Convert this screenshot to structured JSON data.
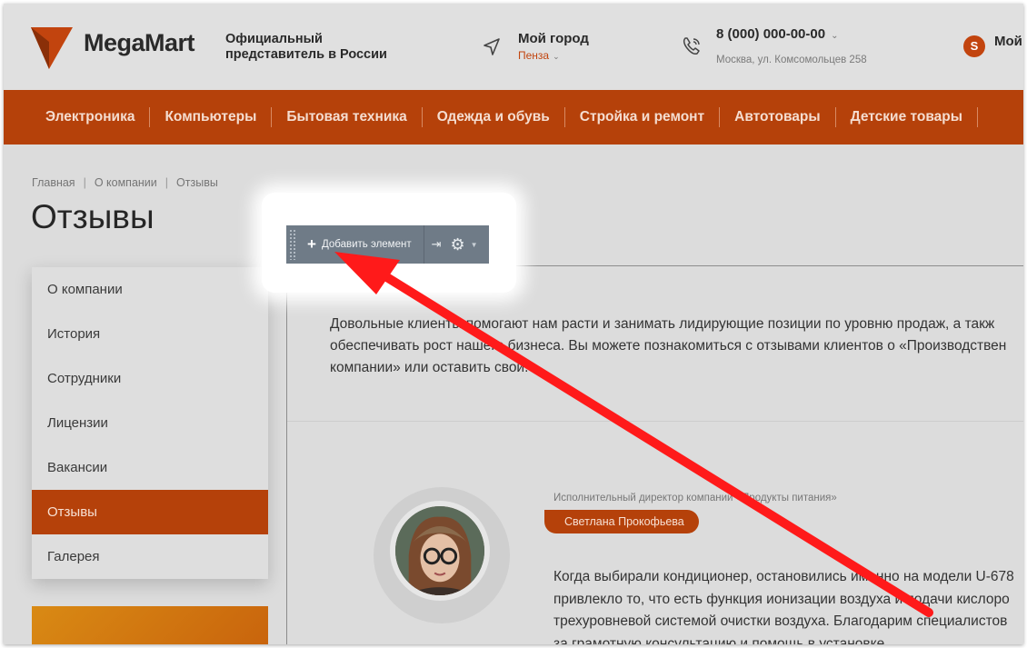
{
  "header": {
    "logo_text": "MegaMart",
    "tagline": "Официальный представитель в России",
    "city_title": "Мой город",
    "city_name": "Пенза",
    "phone": "8 (000) 000-00-00",
    "address": "Москва, ул. Комсомольцев 258",
    "user_initial": "S",
    "user_label": "Мой"
  },
  "nav": {
    "items": [
      "Электроника",
      "Компьютеры",
      "Бытовая техника",
      "Одежда и обувь",
      "Стройка и ремонт",
      "Автотовары",
      "Детские товары"
    ]
  },
  "breadcrumb": [
    "Главная",
    "О компании",
    "Отзывы"
  ],
  "page_title": "Отзывы",
  "sidebar": {
    "items": [
      "О компании",
      "История",
      "Сотрудники",
      "Лицензии",
      "Вакансии",
      "Отзывы",
      "Галерея"
    ],
    "active_index": 5
  },
  "toolbar": {
    "add_label": "Добавить элемент",
    "grip_icon": "drag-grip-icon",
    "pin_icon": "pin-icon",
    "settings_icon": "gear-icon"
  },
  "intro": {
    "line1": "Довольные клиенты помогают нам расти и занимать лидирующие позиции по уровню продаж, а такж",
    "line2": "обеспечивать рост нашего бизнеса. Вы можете познакомиться с отзывами клиентов о «Производствен",
    "line3": "компании» или оставить свой."
  },
  "review": {
    "role": "Исполнительный директор компании «Продукты питания»",
    "name": "Светлана Прокофьева",
    "line1": "Когда выбирали кондиционер, остановились именно на модели U-678",
    "line2": "привлекло то, что есть функция ионизации воздуха и подачи кислоро",
    "line3": "трехуровневой системой очистки воздуха. Благодарим специалистов",
    "line4": "за грамотную консультацию и помощь в установке."
  },
  "colors": {
    "accent": "#b5410a",
    "arrow": "#ff1a1a",
    "toolbar": "#6f7b87"
  }
}
